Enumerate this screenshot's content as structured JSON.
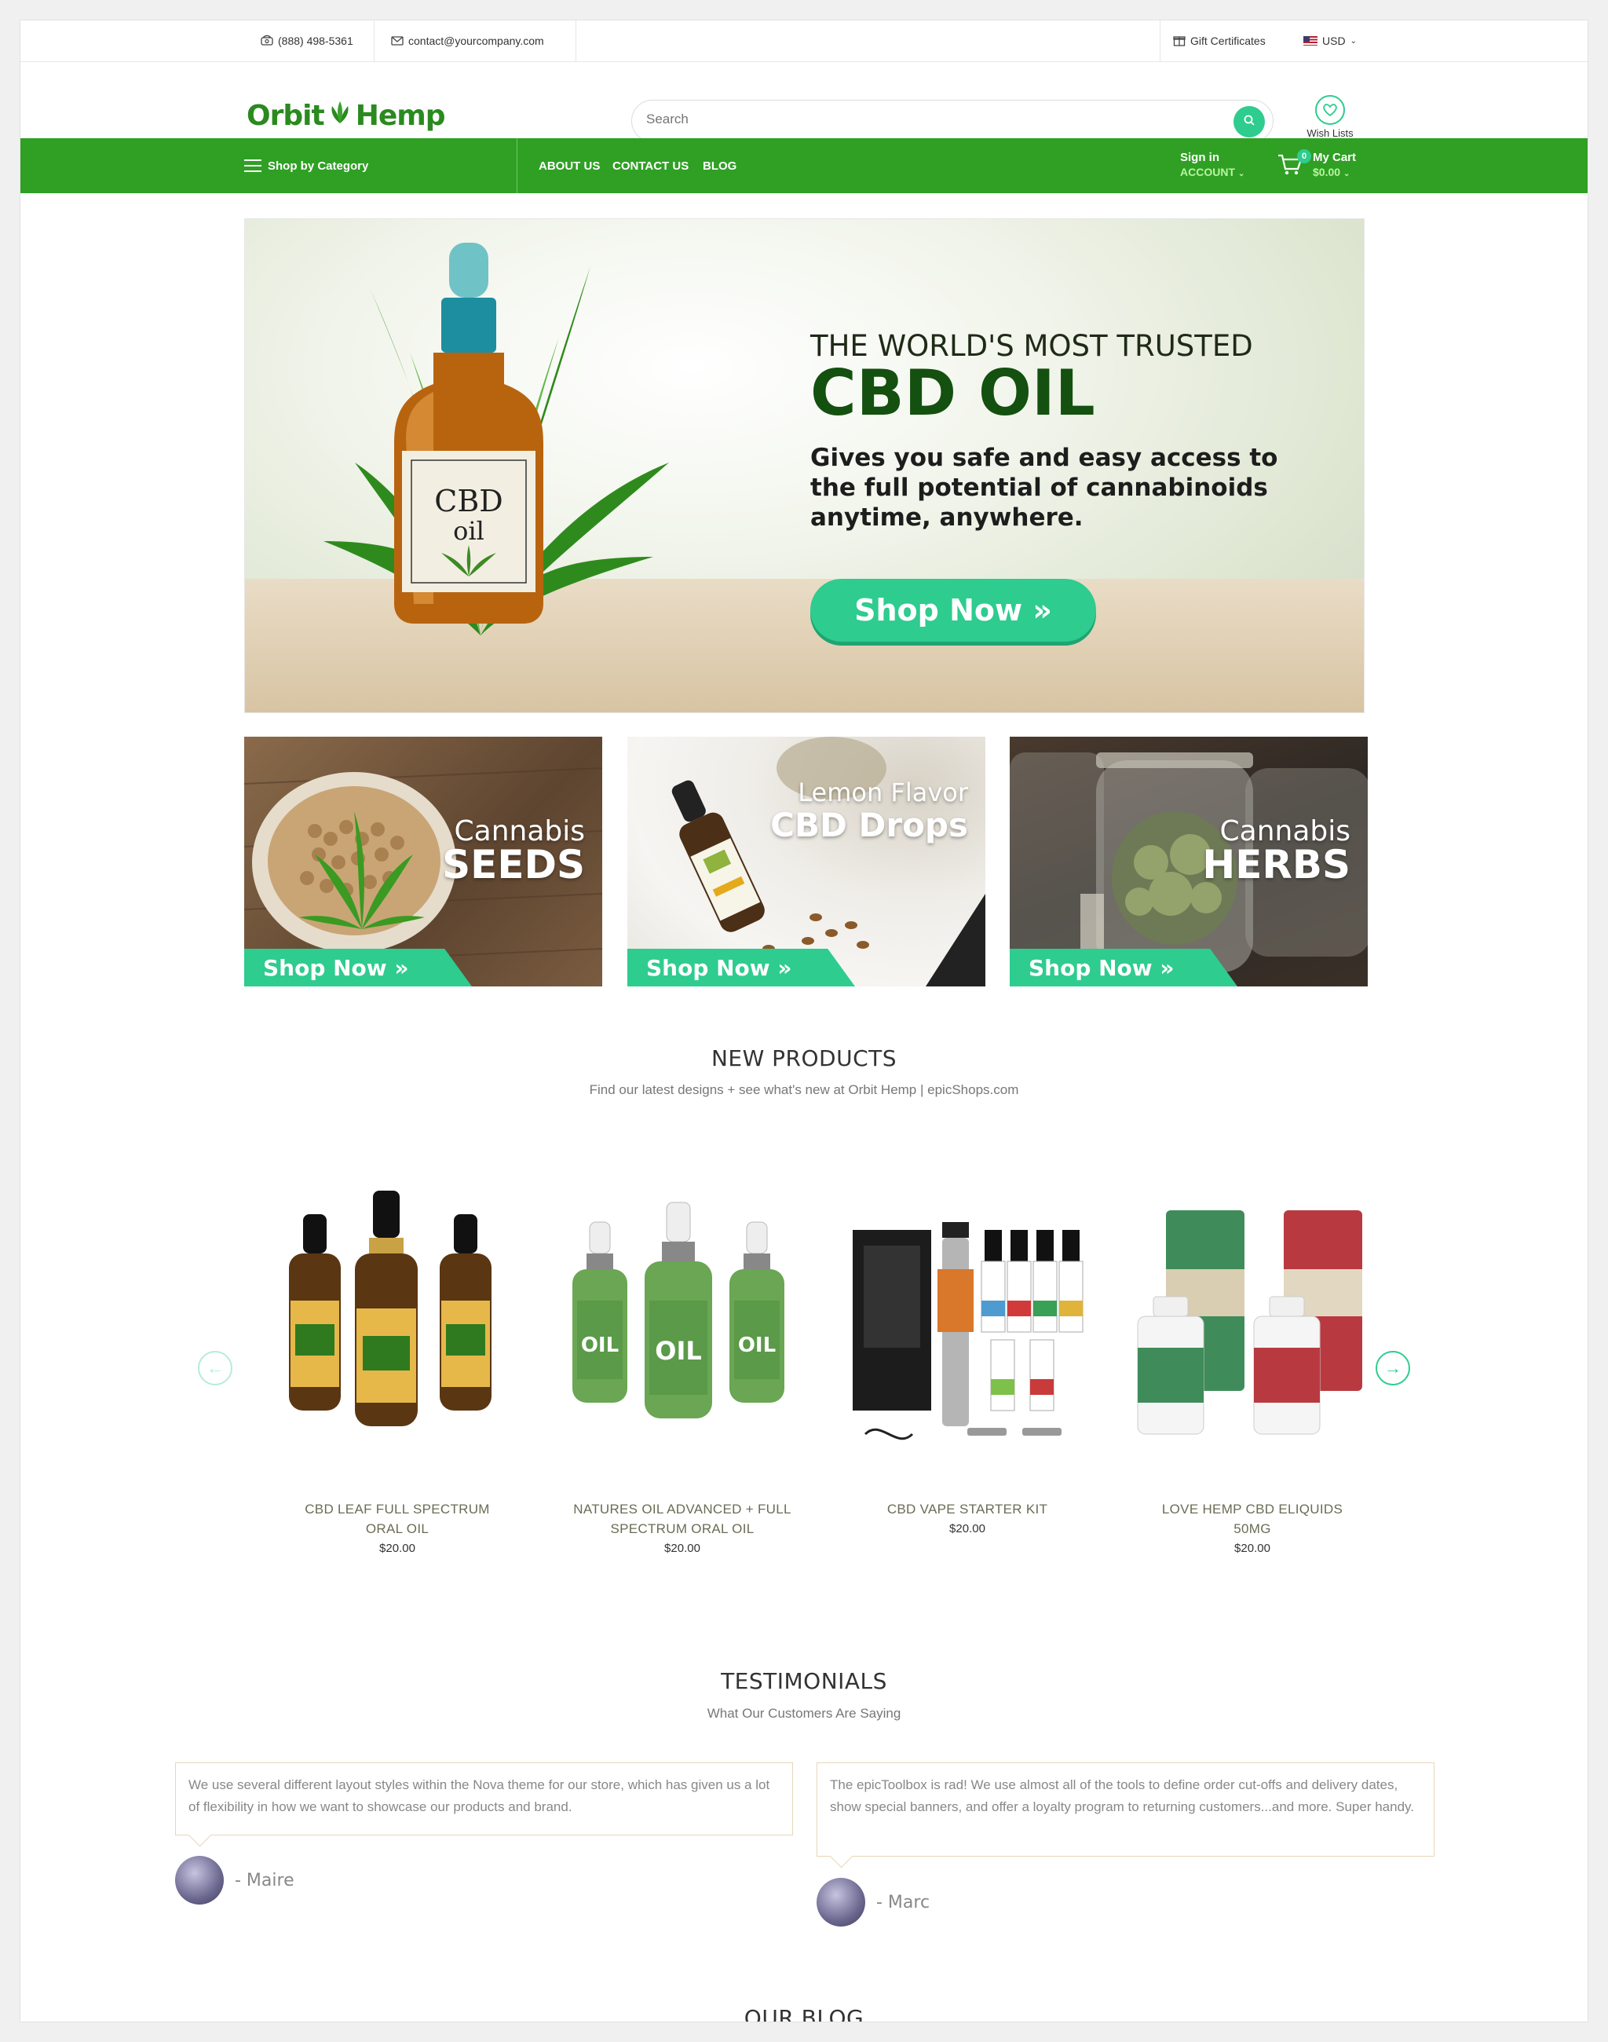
{
  "topbar": {
    "phone": "(888) 498-5361",
    "email": "contact@yourcompany.com",
    "gift": "Gift Certificates",
    "currency": "USD"
  },
  "header": {
    "logo_left": "Orbit",
    "logo_right": "Hemp",
    "search_placeholder": "Search",
    "wishlist_label": "Wish Lists"
  },
  "nav": {
    "shop_by_category": "Shop by Category",
    "links": [
      "ABOUT US",
      "CONTACT US",
      "BLOG"
    ],
    "sign_in": "Sign in",
    "account": "ACCOUNT",
    "cart_label": "My Cart",
    "cart_total": "$0.00",
    "cart_count": "0"
  },
  "hero": {
    "kicker": "THE WORLD'S MOST TRUSTED",
    "title": "CBD OIL",
    "description": "Gives you safe and easy access to the full potential of cannabinoids anytime, anywhere.",
    "button": "Shop Now »",
    "bottle_label_1": "CBD",
    "bottle_label_2": "oil"
  },
  "promos": [
    {
      "line1": "Cannabis",
      "line2": "SEEDS",
      "button": "Shop Now »"
    },
    {
      "line1": "Lemon Flavor",
      "line2": "CBD Drops",
      "button": "Shop Now »"
    },
    {
      "line1": "Cannabis",
      "line2": "HERBS",
      "button": "Shop Now »"
    }
  ],
  "new_products": {
    "title": "NEW PRODUCTS",
    "subtitle": "Find our latest designs + see what's new at Orbit Hemp | epicShops.com",
    "items": [
      {
        "name": "CBD LEAF FULL SPECTRUM ORAL OIL",
        "price": "$20.00"
      },
      {
        "name": "NATURES OIL ADVANCED + FULL SPECTRUM ORAL OIL",
        "price": "$20.00"
      },
      {
        "name": "CBD VAPE STARTER KIT",
        "price": "$20.00"
      },
      {
        "name": "LOVE HEMP CBD ELIQUIDS 50MG",
        "price": "$20.00"
      }
    ]
  },
  "testimonials": {
    "title": "TESTIMONIALS",
    "subtitle": "What Our Customers Are Saying",
    "items": [
      {
        "text": "We use several different layout styles within the Nova theme for our store, which has given us a lot of flexibility in how we want to showcase our products and brand.",
        "author": "- Maire"
      },
      {
        "text": "The epicToolbox is rad! We use almost all of the tools to define order cut-offs and delivery dates, show special banners, and offer a loyalty program to returning customers...and more. Super handy.",
        "author": "- Marc"
      }
    ]
  },
  "blog": {
    "title": "OUR BLOG"
  },
  "colors": {
    "brand_green": "#2fa024",
    "accent_teal": "#2ecc8f",
    "dark_green": "#14500f"
  }
}
